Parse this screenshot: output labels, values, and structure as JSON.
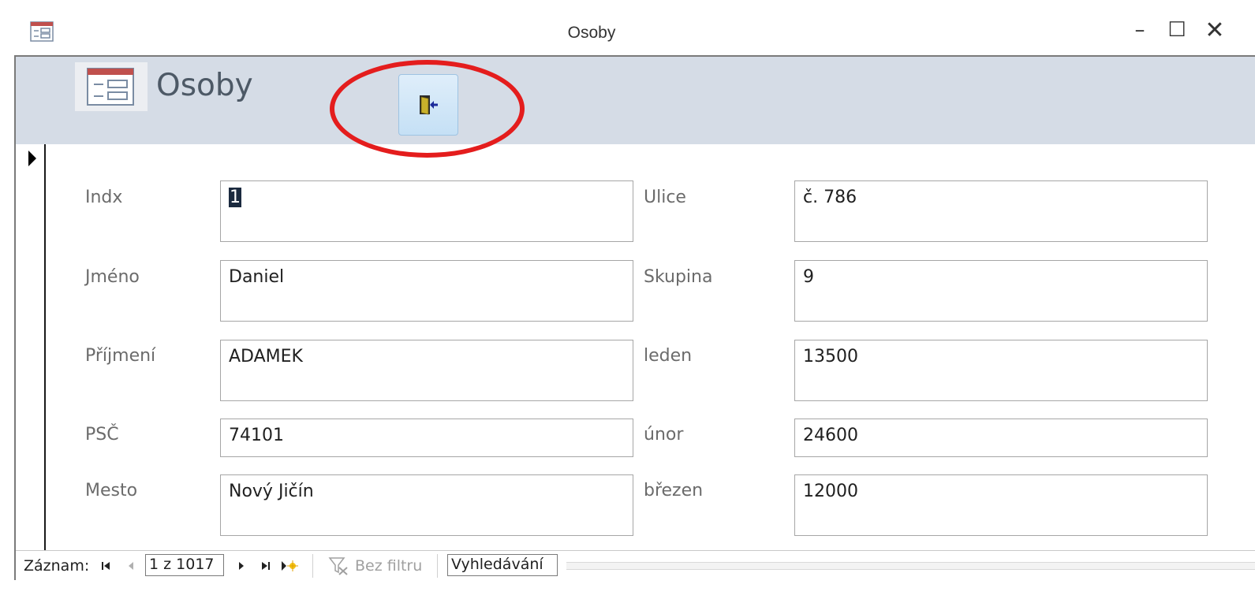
{
  "window": {
    "title": "Osoby",
    "minimize_glyph": "–",
    "maximize_glyph": "☐",
    "close_glyph": "✕"
  },
  "header": {
    "title": "Osoby",
    "icon": "form-icon",
    "close_button_icon": "exit-door-icon",
    "highlight_color": "#e41d1d"
  },
  "fields": {
    "indx": {
      "label": "Indx",
      "value": "1"
    },
    "jmeno": {
      "label": "Jméno",
      "value": "Daniel"
    },
    "prijmeni": {
      "label": "Příjmení",
      "value": "ADAMEK"
    },
    "psc": {
      "label": "PSČ",
      "value": "74101"
    },
    "mesto": {
      "label": "Mesto",
      "value": "Nový Jičín"
    },
    "ulice": {
      "label": "Ulice",
      "value": "č. 786"
    },
    "skupina": {
      "label": "Skupina",
      "value": "9"
    },
    "leden": {
      "label": "leden",
      "value": "13500"
    },
    "unor": {
      "label": "únor",
      "value": "24600"
    },
    "brezen": {
      "label": "březen",
      "value": "12000"
    }
  },
  "navigation": {
    "label": "Záznam:",
    "record_position": "1 z 1017",
    "filter_label": "Bez filtru",
    "search_label": "Vyhledávání"
  },
  "colors": {
    "header_bg": "#d5dce6",
    "accent": "#e41d1d"
  }
}
